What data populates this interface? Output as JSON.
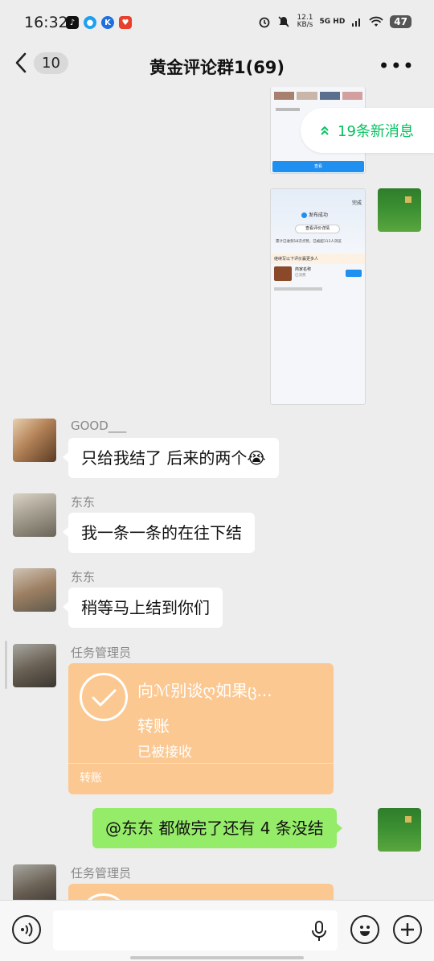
{
  "status_bar": {
    "time": "16:32",
    "speed_value": "12.1",
    "speed_unit": "KB/s",
    "network": "5G HD",
    "battery": "47"
  },
  "nav": {
    "unread_count": "10",
    "title": "黄金评论群1(69)",
    "more": "•••"
  },
  "new_messages": {
    "label": "19条新消息"
  },
  "screenshot_top": {
    "button": "查看"
  },
  "screenshot_image": {
    "done": "完成",
    "success": "发布成功",
    "view_review": "查看评价详情",
    "stats": "累计已收到18次点赞，已被超113人浏览",
    "promo": "继续写以下评价赢更多人",
    "shop": "商家名称",
    "tag": "已消费"
  },
  "messages": [
    {
      "sender": "GOOD___",
      "text": "只给我结了 后来的两个😭"
    },
    {
      "sender": "东东",
      "text": "我一条一条的在往下结"
    },
    {
      "sender": "东东",
      "text": "稍等马上结到你们"
    },
    {
      "sender": "任务管理员",
      "transfer": {
        "name": "向ℳ别谈ღ如果ც...",
        "label": "转账",
        "status": "已被接收",
        "footer": "转账"
      }
    },
    {
      "mine": true,
      "text": "@东东  都做完了还有 4 条没结"
    },
    {
      "sender": "任务管理员"
    }
  ],
  "input": {
    "placeholder": ""
  }
}
